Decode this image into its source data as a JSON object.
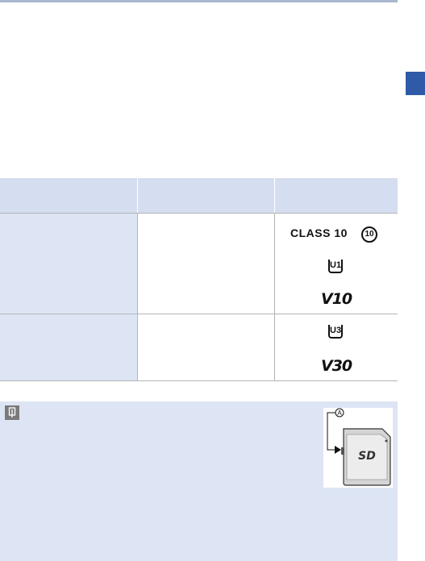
{
  "table": {
    "rows": [
      {
        "symbols": [
          "CLASS 10",
          "10",
          "U1",
          "V10"
        ]
      },
      {
        "symbols": [
          "U3",
          "V30"
        ]
      }
    ]
  },
  "note": {
    "callout_label": "A",
    "card_logo": "SD"
  },
  "colors": {
    "accent": "#2f5aa8",
    "header_fill": "#d5def0",
    "panel_fill": "#dde5f5"
  },
  "icons": [
    "memo-icon",
    "sd-card-icon",
    "write-protect-arrow-icon"
  ]
}
